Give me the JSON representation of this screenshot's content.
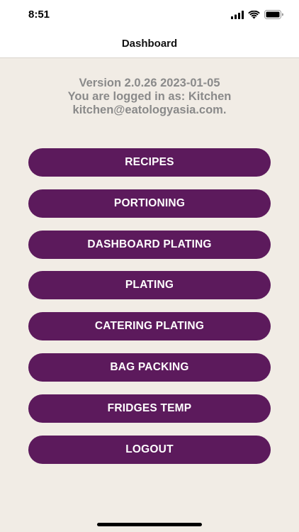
{
  "status_bar": {
    "time": "8:51",
    "icons": [
      "signal-icon",
      "wifi-icon",
      "battery-icon"
    ]
  },
  "nav": {
    "title": "Dashboard"
  },
  "info": {
    "version": "Version 2.0.26 2023-01-05",
    "logged_in": "You are logged in as:  Kitchen",
    "email": "kitchen@eatologyasia.com."
  },
  "menu": {
    "items": [
      {
        "label": "RECIPES"
      },
      {
        "label": "PORTIONING"
      },
      {
        "label": "DASHBOARD PLATING"
      },
      {
        "label": "PLATING"
      },
      {
        "label": "CATERING PLATING"
      },
      {
        "label": "BAG PACKING"
      },
      {
        "label": "FRIDGES TEMP"
      },
      {
        "label": "LOGOUT"
      }
    ]
  },
  "colors": {
    "background": "#f1ece5",
    "button": "#5c1a5c",
    "button_text": "#ffffff",
    "info_text": "#8a8a8a"
  }
}
